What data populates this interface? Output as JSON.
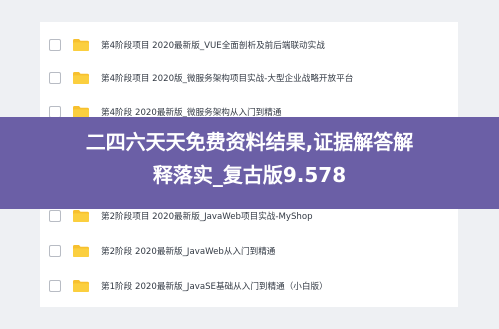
{
  "files": [
    {
      "name": "第4阶段项目 2020最新版_VUE全面剖析及前后端联动实战",
      "icon": "folder-icon"
    },
    {
      "name": "第4阶段项目 2020版_微服务架构项目实战-大型企业战略开放平台",
      "icon": "folder-icon"
    },
    {
      "name": "第4阶段        2020最新版_微服务架构从入门到精通",
      "icon": "folder-icon"
    },
    {
      "name": "",
      "icon": "folder-icon"
    },
    {
      "name": "第2阶段项目 2020最新版_JavaWeb项目实战-MyShop",
      "icon": "folder-icon"
    },
    {
      "name": "第2阶段        2020最新版_JavaWeb从入门到精通",
      "icon": "folder-icon"
    },
    {
      "name": "第1阶段        2020最新版_JavaSE基础从入门到精通（小白版）",
      "icon": "folder-icon"
    }
  ],
  "overlay": {
    "line1": "二四六天天免费资料结果,证据解答解",
    "line2": "释落实_复古版9.578"
  },
  "colors": {
    "folder": "#f7c02f",
    "overlay": "#6b5fa6"
  }
}
